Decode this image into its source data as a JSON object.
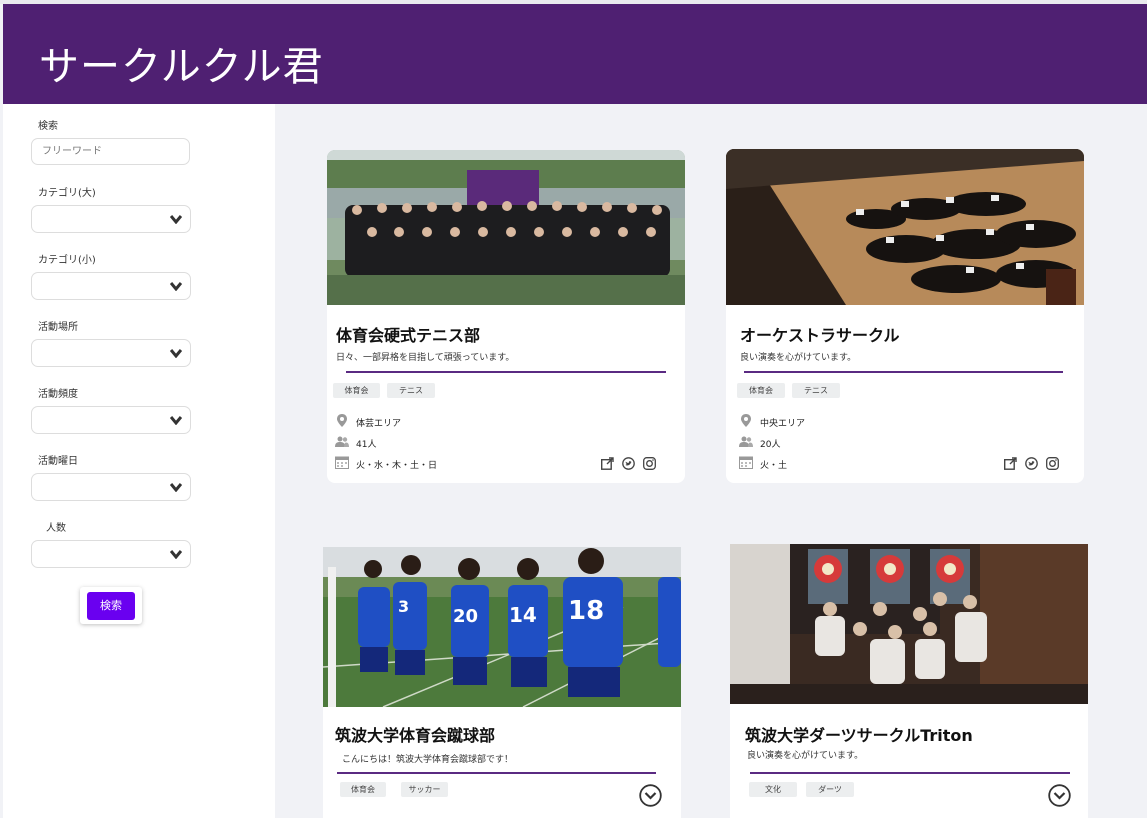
{
  "app": {
    "title": "サークルクル君"
  },
  "sidebar": {
    "search_label": "検索",
    "search_placeholder": "フリーワード",
    "filters": [
      {
        "label": "カテゴリ(大)"
      },
      {
        "label": "カテゴリ(小)"
      },
      {
        "label": "活動場所"
      },
      {
        "label": "活動頻度"
      },
      {
        "label": "活動曜日"
      },
      {
        "label": "人数"
      }
    ],
    "search_button": "検索"
  },
  "cards": [
    {
      "title": "体育会硬式テニス部",
      "description": "日々、一部昇格を目指して頑張っています。",
      "tags": [
        "体育会",
        "テニス"
      ],
      "location": "体芸エリア",
      "members": "41人",
      "days": "火・水・木・土・日",
      "photo_icon": "team-photo"
    },
    {
      "title": "オーケストラサークル",
      "description": "良い演奏を心がけています。",
      "tags": [
        "体育会",
        "テニス"
      ],
      "location": "中央エリア",
      "members": "20人",
      "days": "火・土",
      "photo_icon": "orchestra-photo"
    },
    {
      "title": "筑波大学体育会蹴球部",
      "description": "こんにちは！筑波大学体育会蹴球部です！",
      "tags": [
        "体育会",
        "サッカー"
      ],
      "photo_icon": "soccer-photo"
    },
    {
      "title": "筑波大学ダーツサークルTriton",
      "description": "良い演奏を心がけています。",
      "tags": [
        "文化",
        "ダーツ"
      ],
      "photo_icon": "darts-photo"
    }
  ],
  "colors": {
    "header": "#4f2072",
    "accent_line": "#5a2a82",
    "button": "#6a00f0",
    "background": "#f1f2f6"
  }
}
